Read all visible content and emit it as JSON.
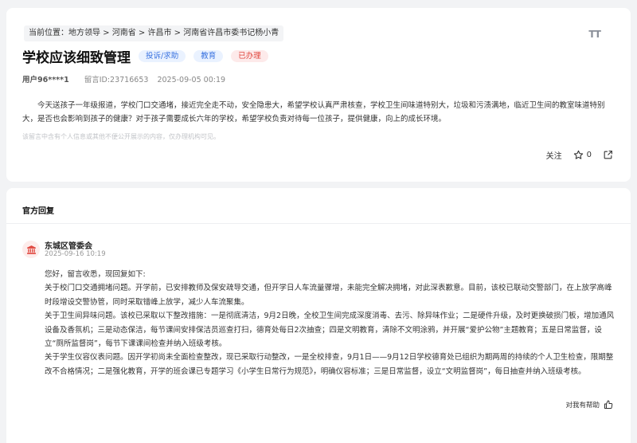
{
  "post": {
    "breadcrumb": "当前位置：地方领导 > 河南省 > 许昌市 > 河南省许昌市委书记杨小青",
    "font_toggle": "TT",
    "title": "学校应该细致管理",
    "tags": [
      "投诉/求助",
      "教育",
      "已办理"
    ],
    "user": "用户96****1",
    "post_id": "留言ID:23716653",
    "datetime": "2025-09-05 00:19",
    "body": "今天送孩子一年级报道，学校门口交通堵，接近完全走不动，安全隐患大，希望学校认真严肃核查，学校卫生间味道特别大，垃圾和污渍满地，临近卫生间的教室味道特别大，是否也会影响到孩子的健康？对于孩子需要成长六年的学校，希望学校负责对待每一位孩子，提供健康，向上的成长环境。",
    "privacy_note": "该留言中含有个人信息或其他不便公开展示的内容，仅办理机构可见。",
    "follow_label": "关注",
    "star_count": "0"
  },
  "reply": {
    "heading": "官方回复",
    "org_name": "东城区管委会",
    "date": "2025-09-16 10:19",
    "paragraphs": [
      "您好，留言收悉，现回复如下:",
      "关于校门口交通拥堵问题。开学前，已安排教师及保安疏导交通，但开学日人车流量骤增，未能完全解决拥堵，对此深表歉意。目前，该校已联动交警部门，在上放学高峰时段增设交警协管，同时采取错峰上放学，减少人车流聚集。",
      "关于卫生间异味问题。该校已采取以下整改措施：一是彻底清洁，9月2日晚，全校卫生间完成深度消毒、去污、除异味作业；二是硬件升级，及时更换破损门板，增加通风设备及香氛机；三是动态保洁，每节课间安排保洁员巡查打扫，德育处每日2次抽查；四是文明教育，清除不文明涂鸦，并开展“爱护公物”主题教育；五是日常监督，设立“厕所监督岗”，每节下课课间检查并纳入班级考核。",
      "关于学生仪容仪表问题。因开学初尚未全面检查整改，现已采取行动整改，一是全校排查，9月1日——9月12日学校德育处已组织为期两周的持续的个人卫生检查，限期整改不合格情况；二是强化教育，开学的班会课已专题学习《小学生日常行为规范》，明确仪容标准；三是日常监督，设立“文明监督岗”，每日抽查并纳入班级考核。"
    ],
    "helpful_label": "对我有帮助"
  },
  "colors": {
    "tag_blue_text": "#3a73e0",
    "tag_blue_bg": "#eaf2ff",
    "tag_red_text": "#e0473f",
    "tag_red_bg": "#fdeaea",
    "avatar_icon": "#e0473f"
  },
  "icons": {
    "font_size": "font-size-icon",
    "star": "star-icon",
    "share": "share-icon",
    "avatar": "government-building-icon",
    "helpful": "thumbs-up-icon"
  }
}
